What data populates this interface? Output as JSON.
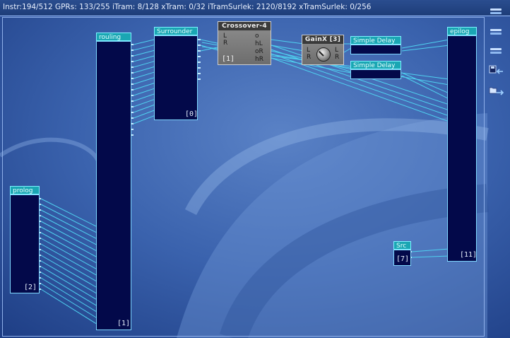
{
  "status_bar": {
    "text": "Instr:194/512 GPRs: 133/255 iTram: 8/128 xTram: 0/32 iTramSurlek: 2120/8192 xTramSurlek: 0/256"
  },
  "toolbar": {
    "buttons": [
      "menu-line-icon",
      "menu-line-icon",
      "menu-line-icon",
      "save-arrow-icon",
      "open-folder-arrow-icon"
    ]
  },
  "modules": {
    "routing": {
      "title": "rouling",
      "badge": "[1]"
    },
    "surrounder": {
      "title": "Surrounder",
      "badge": "[0]"
    },
    "crossover": {
      "title": "Crossover-4",
      "badge": "[1]",
      "in_l": "L",
      "in_r": "R",
      "out1": "o",
      "out2": "hL",
      "out3": "oR",
      "out4": "hR"
    },
    "gainx": {
      "title": "GainX [3]",
      "in_l": "L",
      "in_r": "R",
      "out_l": "L",
      "out_r": "R"
    },
    "simple_delay_1": {
      "title": "Simple Delay"
    },
    "simple_delay_2": {
      "title": "Simple Delay"
    },
    "epilog": {
      "title": "epilog",
      "badge": "[11]"
    },
    "prolog": {
      "title": "prolog",
      "badge": "[2]"
    },
    "src": {
      "title": "Src",
      "badge": "[7]"
    }
  },
  "colors": {
    "module_body": "#03094a",
    "module_title": "#1aa6b3",
    "wire": "#4fd2f0",
    "status_bar": "#1e3d79"
  }
}
